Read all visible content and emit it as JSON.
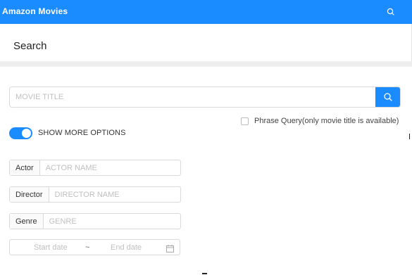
{
  "app": {
    "title": "Amazon Movies"
  },
  "header": {
    "page_title": "Search"
  },
  "search": {
    "movie_title_placeholder": "MOVIE TITLE",
    "movie_title_value": ""
  },
  "phrase_query": {
    "label": "Phrase Query(only movie title is available)",
    "checked": false
  },
  "more_options": {
    "label": "SHOW MORE OPTIONS",
    "enabled": true
  },
  "fields": {
    "actor": {
      "label": "Actor",
      "placeholder": "ACTOR NAME"
    },
    "director": {
      "label": "Director",
      "placeholder": "DIRECTOR NAME"
    },
    "genre": {
      "label": "Genre",
      "placeholder": "GENRE"
    }
  },
  "date_range": {
    "start_placeholder": "Start date",
    "separator": "~",
    "end_placeholder": "End date"
  },
  "colors": {
    "primary": "#1a8cff",
    "border": "#d9d9d9",
    "placeholder": "#bfbfbf"
  },
  "icons": {
    "top_search": "search-icon",
    "submit_search": "search-icon",
    "calendar": "calendar-icon"
  }
}
